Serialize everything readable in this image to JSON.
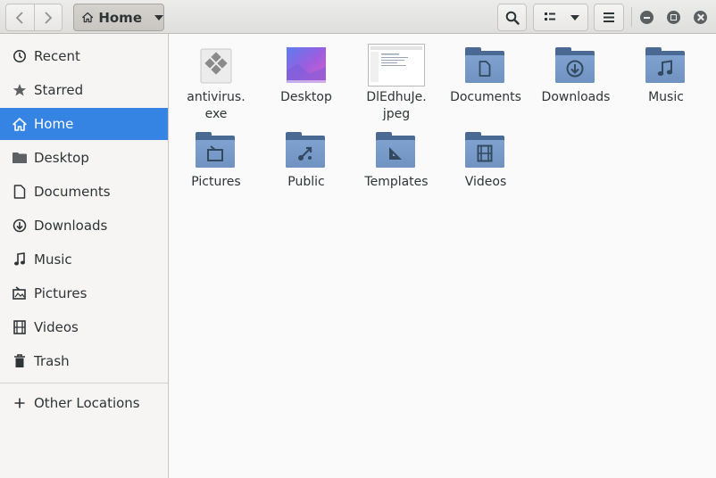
{
  "window": {
    "location_label": "Home"
  },
  "sidebar": {
    "items": [
      {
        "label": "Recent",
        "icon": "clock-icon"
      },
      {
        "label": "Starred",
        "icon": "star-icon"
      },
      {
        "label": "Home",
        "icon": "home-icon",
        "active": true
      },
      {
        "label": "Desktop",
        "icon": "folder-icon"
      },
      {
        "label": "Documents",
        "icon": "document-icon"
      },
      {
        "label": "Downloads",
        "icon": "download-icon"
      },
      {
        "label": "Music",
        "icon": "music-note-icon"
      },
      {
        "label": "Pictures",
        "icon": "picture-icon"
      },
      {
        "label": "Videos",
        "icon": "film-icon"
      },
      {
        "label": "Trash",
        "icon": "trash-icon"
      }
    ],
    "other_locations": {
      "label": "Other Locations",
      "icon": "plus-icon"
    }
  },
  "files": [
    {
      "label": "antivirus.\nexe",
      "type": "executable",
      "icon": "executable-icon"
    },
    {
      "label": "Desktop",
      "type": "folder",
      "icon": "desktop-folder-icon"
    },
    {
      "label": "DlEdhuJe.\njpeg",
      "type": "image",
      "icon": "image-thumbnail-icon"
    },
    {
      "label": "Documents",
      "type": "folder",
      "icon": "documents-folder-icon"
    },
    {
      "label": "Downloads",
      "type": "folder",
      "icon": "downloads-folder-icon"
    },
    {
      "label": "Music",
      "type": "folder",
      "icon": "music-folder-icon"
    },
    {
      "label": "Pictures",
      "type": "folder",
      "icon": "pictures-folder-icon"
    },
    {
      "label": "Public",
      "type": "folder",
      "icon": "public-folder-icon"
    },
    {
      "label": "Templates",
      "type": "folder",
      "icon": "templates-folder-icon"
    },
    {
      "label": "Videos",
      "type": "folder",
      "icon": "videos-folder-icon"
    }
  ],
  "colors": {
    "accent": "#3584e4",
    "folder": "#7fa2d0",
    "folder_dark": "#4a6a93"
  }
}
